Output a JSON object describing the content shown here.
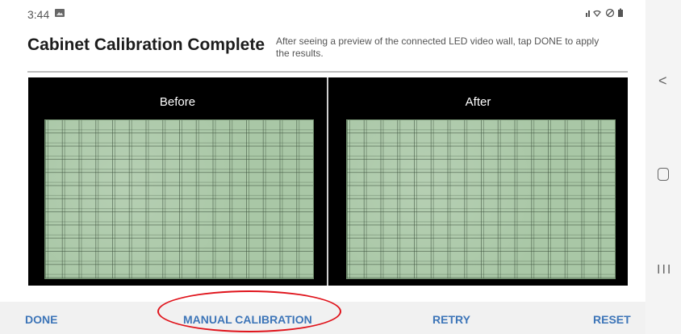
{
  "status_bar": {
    "time": "3:44",
    "icons": "█≈⦸■"
  },
  "header": {
    "title": "Cabinet Calibration Complete",
    "description": "After seeing a preview of the connected LED video wall, tap DONE to apply the results."
  },
  "preview": {
    "before_label": "Before",
    "after_label": "After"
  },
  "nav": {
    "back": "<",
    "recent": "III"
  },
  "actions": {
    "done": "DONE",
    "manual_calibration": "MANUAL CALIBRATION",
    "retry": "RETRY",
    "reset": "RESET"
  },
  "colors": {
    "action_text": "#3d75b8",
    "highlight": "#e0141c",
    "wall": "#a9c7a6"
  }
}
